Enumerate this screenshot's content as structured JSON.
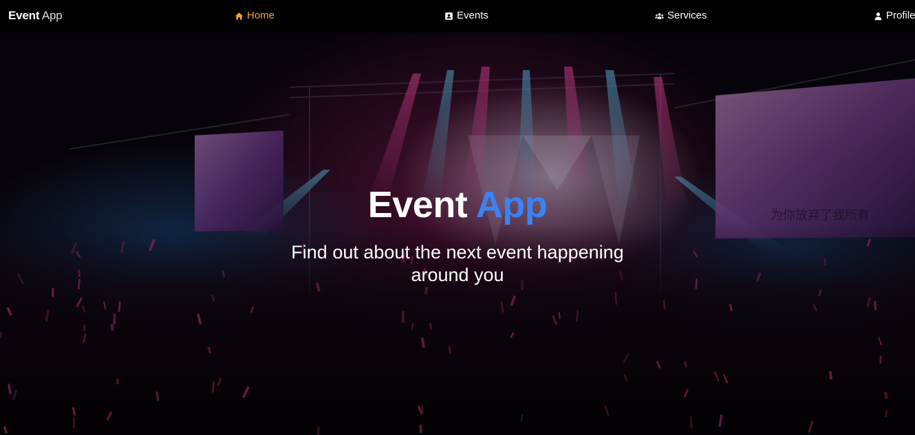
{
  "brand": {
    "bold": "Event",
    "light": "App"
  },
  "nav": {
    "home": {
      "label": "Home",
      "icon": "home-icon",
      "active": true
    },
    "events": {
      "label": "Events",
      "icon": "id-card-icon"
    },
    "services": {
      "label": "Services",
      "icon": "users-icon"
    },
    "profile": {
      "label": "Profile",
      "icon": "user-icon"
    }
  },
  "hero": {
    "title_main": "Event",
    "title_accent": "App",
    "subtitle": "Find out about the next event happening around you",
    "screen_text": "为你放弃了我所有"
  },
  "colors": {
    "navbar_bg": "#000000",
    "active_nav": "#f5a524",
    "accent": "#3b82f6",
    "text": "#ffffff"
  }
}
